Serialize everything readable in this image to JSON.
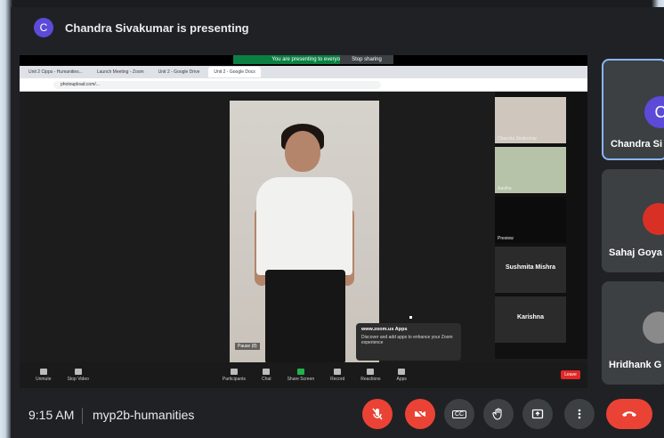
{
  "presenter": {
    "initial": "C",
    "text": "Chandra Sivakumar is presenting"
  },
  "share": {
    "status": "You are presenting to everyone",
    "stop": "Stop sharing"
  },
  "browser": {
    "tabs": [
      "Unit 2 Cipps - Humanities...",
      "Launch Meeting - Zoom",
      "Unit 2 - Google Drive",
      "Unit 2 - Google Docs"
    ],
    "url": "photoupload.com/..."
  },
  "zoom": {
    "participants": [
      "Chandra Sivakumar",
      "Aastha",
      "Preview",
      "Sushmita Mishra",
      "Karishna"
    ],
    "pause": "Pause (8)",
    "toolbar": [
      "Unmute",
      "Stop Video",
      "Participants",
      "Chat",
      "Share Screen",
      "Record",
      "Reactions",
      "Apps"
    ],
    "leave": "Leave",
    "notification_title": "www.zoom.us Apps",
    "notification_body": "Discover and add apps to enhance your Zoom experience"
  },
  "tiles": [
    {
      "name": "Chandra Si",
      "initial": "C",
      "avatar_color": "#5b4bd8"
    },
    {
      "name": "Sahaj Goya",
      "initial": "",
      "avatar_color": "#d93025"
    },
    {
      "name": "Hridhank G",
      "initial": "",
      "avatar_color": "#8a8a8a"
    }
  ],
  "footer": {
    "time": "9:15 AM",
    "meeting": "myp2b-humanities"
  },
  "controls": {
    "mic": "mic-off-icon",
    "camera": "camera-off-icon",
    "captions": "CC",
    "hand": "hand-icon",
    "present": "present-icon",
    "more": "more-icon",
    "end": "end-call-icon"
  },
  "colors": {
    "accent_red": "#ea4335",
    "accent_purple": "#5b4bd8",
    "bg": "#202124"
  }
}
